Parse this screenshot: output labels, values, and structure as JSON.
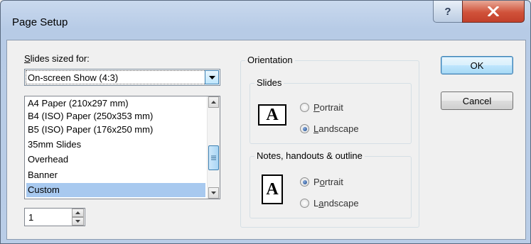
{
  "window": {
    "title": "Page Setup",
    "help_glyph": "?",
    "close_glyph": "X"
  },
  "slides_sized_for": {
    "label_prefix": "S",
    "label_rest": "lides sized for:",
    "selected": "On-screen Show (4:3)",
    "options": [
      "A4 Paper (210x297 mm)",
      "B4 (ISO) Paper (250x353 mm)",
      "B5 (ISO) Paper (176x250 mm)",
      "35mm Slides",
      "Overhead",
      "Banner",
      "Custom"
    ],
    "highlighted_index": 6,
    "spinner_value": "1"
  },
  "orientation": {
    "title": "Orientation",
    "slides": {
      "title": "Slides",
      "icon_letter": "A",
      "portrait_prefix": "",
      "portrait_key": "P",
      "portrait_rest": "ortrait",
      "landscape_key": "L",
      "landscape_rest": "andscape",
      "selected": "landscape"
    },
    "notes": {
      "title": "Notes, handouts & outline",
      "icon_letter": "A",
      "portrait_pre": "P",
      "portrait_key": "o",
      "portrait_rest": "rtrait",
      "landscape_pre": "L",
      "landscape_key": "a",
      "landscape_rest": "ndscape",
      "selected": "portrait"
    }
  },
  "buttons": {
    "ok": "OK",
    "cancel": "Cancel"
  },
  "colors": {
    "selection": "#a8c9ef",
    "title_bar": "#b9cde7",
    "close_button": "#c3402b"
  }
}
